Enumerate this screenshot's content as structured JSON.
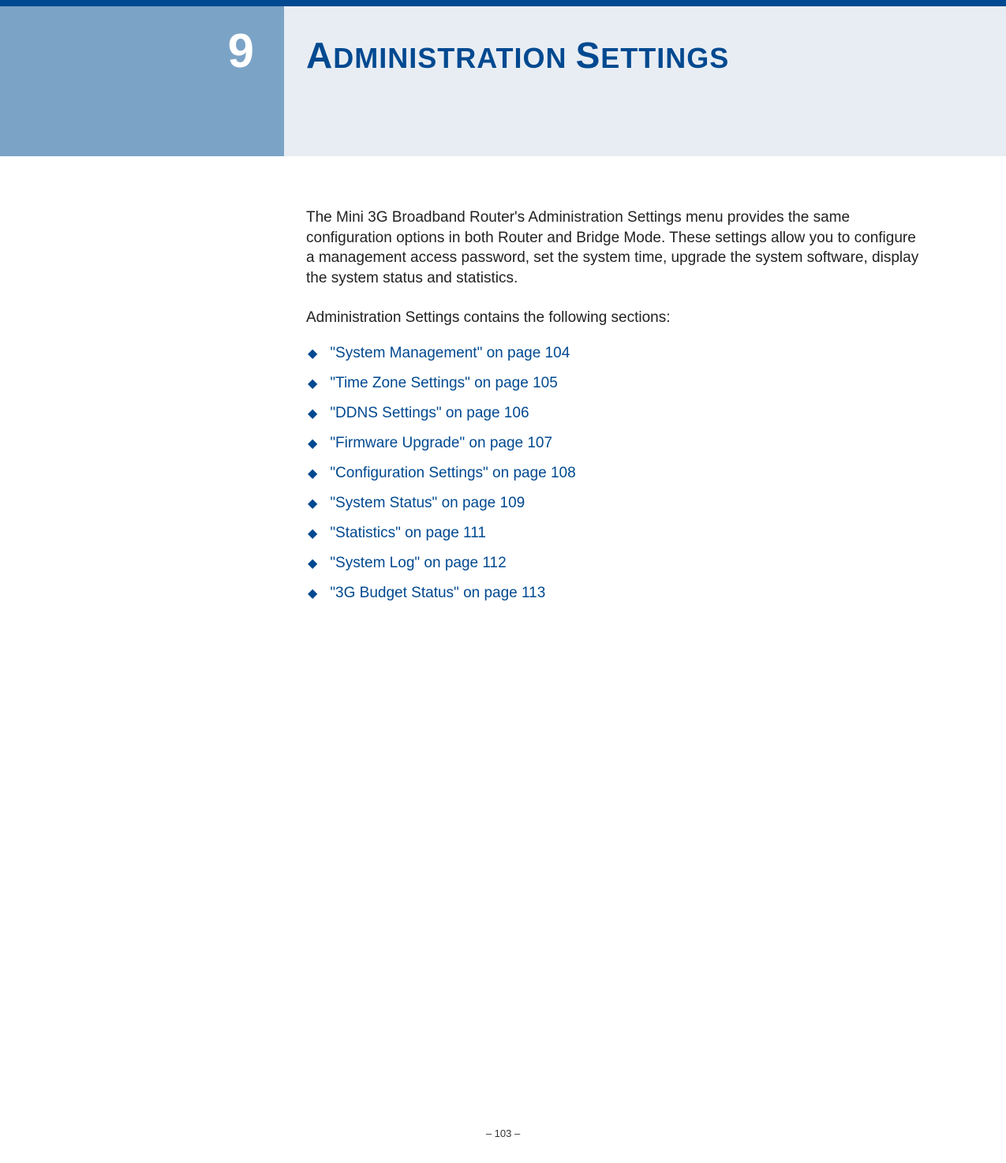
{
  "chapter": {
    "number": "9",
    "title_word1_first": "A",
    "title_word1_rest": "DMINISTRATION",
    "title_word2_first": "S",
    "title_word2_rest": "ETTINGS"
  },
  "intro": "The Mini 3G Broadband Router's Administration Settings menu provides the same configuration options in both Router and Bridge Mode. These settings allow you to configure a management access password, set the system time, upgrade the system software, display the system status and statistics.",
  "sections_intro": "Administration Settings contains the following sections:",
  "toc_items": [
    "\"System Management\" on page 104",
    "\"Time Zone Settings\" on page 105",
    "\"DDNS Settings\" on page 106",
    "\"Firmware Upgrade\" on page 107",
    "\"Configuration Settings\" on page 108",
    "\"System Status\" on page 109",
    "\"Statistics\" on page 111",
    "\"System Log\" on page 112",
    "\"3G Budget Status\" on page 113"
  ],
  "footer": "–  103  –"
}
